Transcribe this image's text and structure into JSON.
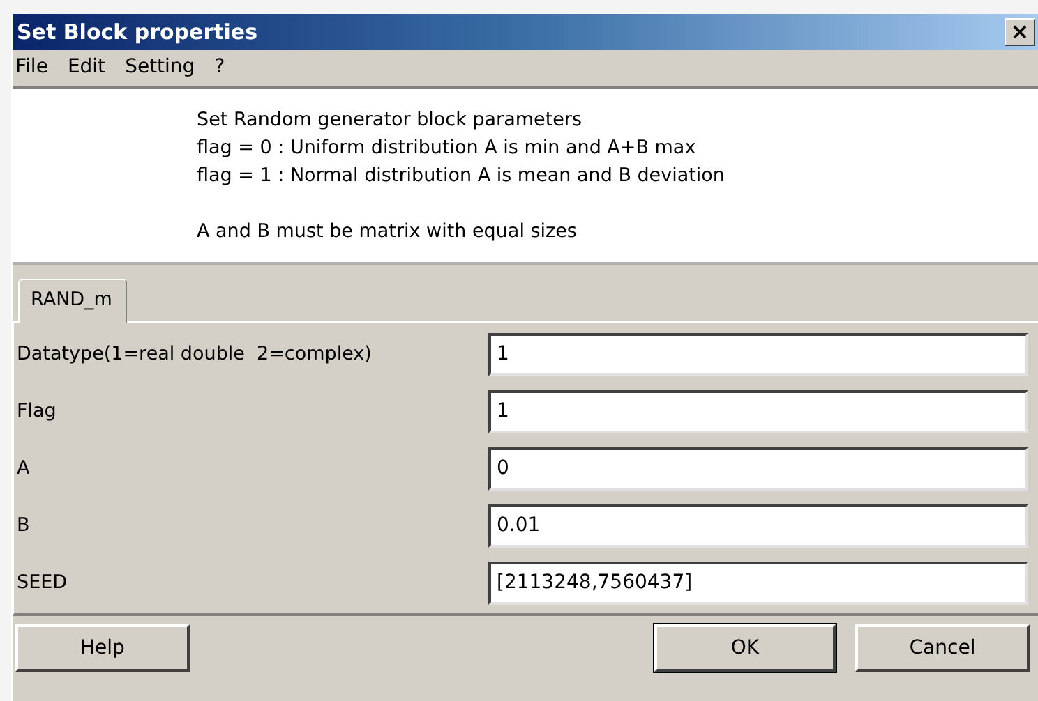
{
  "window": {
    "title": "Set Block properties",
    "close": "×"
  },
  "menu": [
    "File",
    "Edit",
    "Setting",
    "?"
  ],
  "description": [
    [
      "Set Random generator block parameters",
      "flag = 0 : Uniform distribution A is min and A+B max",
      "flag = 1 : Normal distribution A is mean and B deviation"
    ],
    [
      "A and B must be matrix with equal sizes"
    ]
  ],
  "tabs": [
    {
      "label": "RAND_m",
      "selected": true
    }
  ],
  "fields": [
    {
      "label": "Datatype(1=real double  2=complex)",
      "value": "1"
    },
    {
      "label": "Flag",
      "value": "1"
    },
    {
      "label": "A",
      "value": "0"
    },
    {
      "label": "B",
      "value": "0.01"
    },
    {
      "label": "SEED",
      "value": "[2113248,7560437]"
    }
  ],
  "buttons": [
    {
      "label": "Help",
      "kind": "help"
    },
    {
      "label": "OK",
      "kind": "default"
    },
    {
      "label": "Cancel",
      "kind": "normal"
    }
  ]
}
